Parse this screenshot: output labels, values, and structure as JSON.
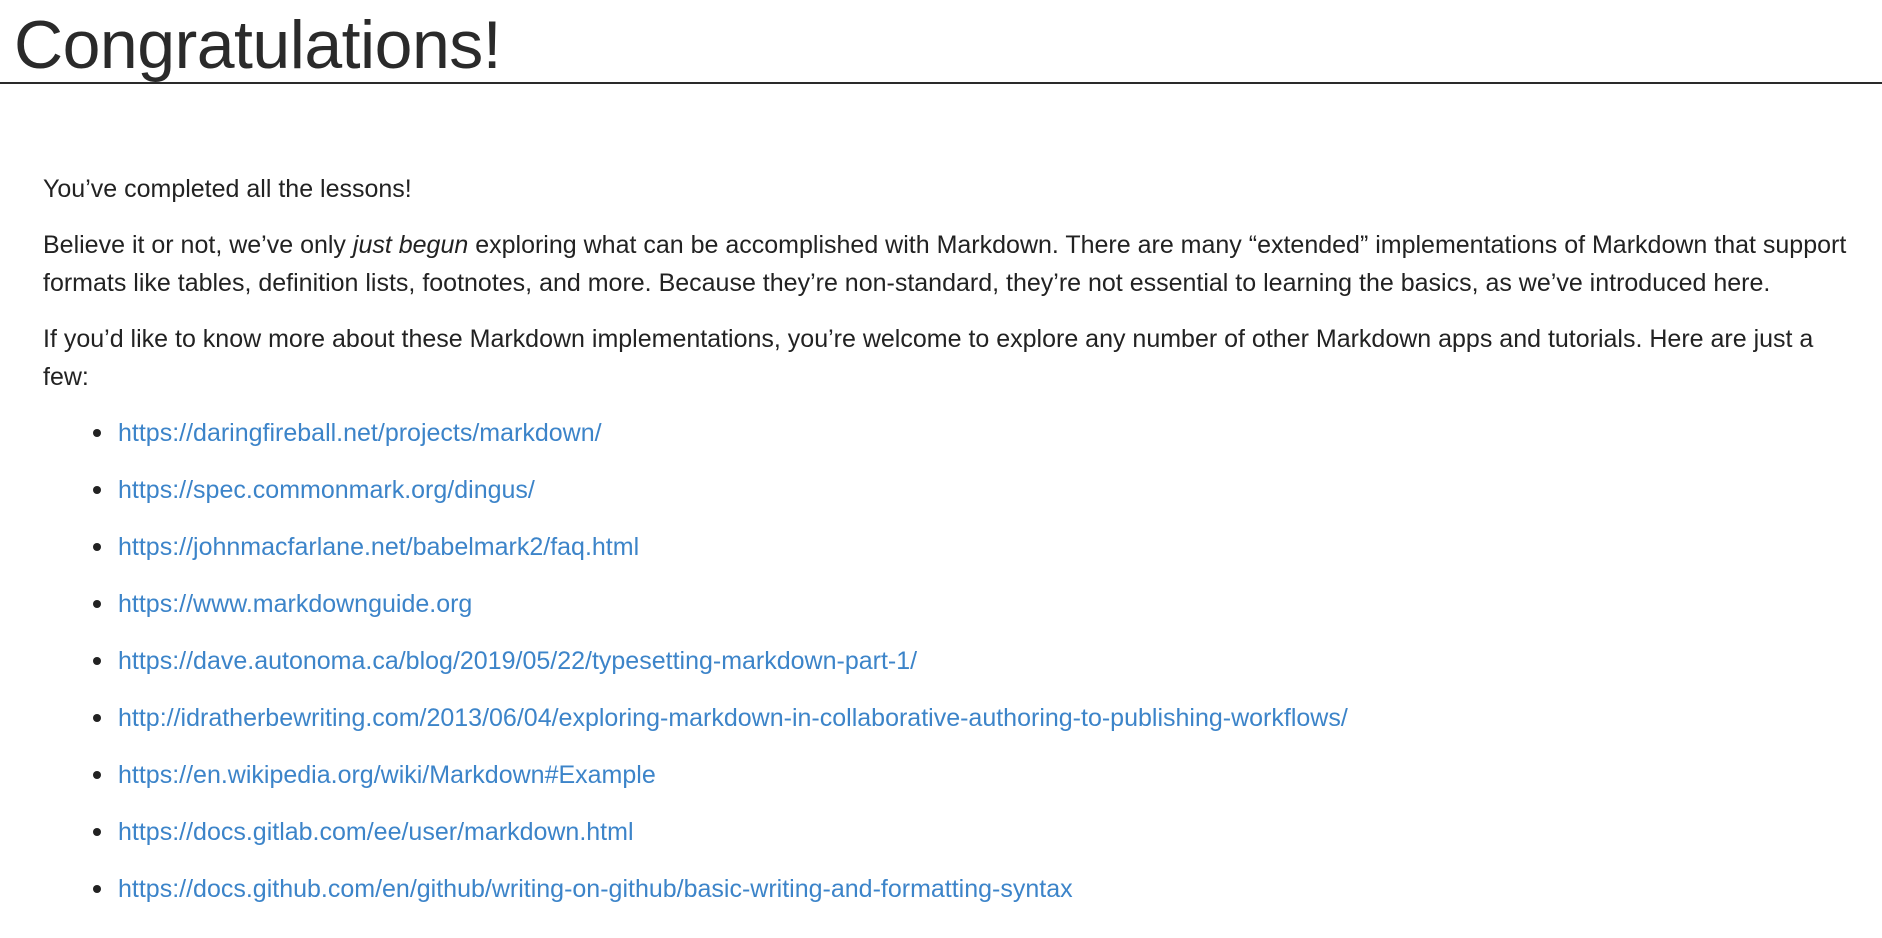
{
  "page": {
    "title": "Congratulations!"
  },
  "content": {
    "p1": "You’ve completed all the lessons!",
    "p2": {
      "before": "Believe it or not, we’ve only ",
      "emphasis": "just begun",
      "after": " exploring what can be accomplished with Markdown. There are many “extended” implementations of Markdown that support formats like tables, definition lists, footnotes, and more. Because they’re non-standard, they’re not essential to learning the basics, as we’ve introduced here."
    },
    "p3": "If you’d like to know more about these Markdown implementations, you’re welcome to explore any number of other Markdown apps and tutorials. Here are just a few:",
    "links": [
      "https://daringfireball.net/projects/markdown/",
      "https://spec.commonmark.org/dingus/",
      "https://johnmacfarlane.net/babelmark2/faq.html",
      "https://www.markdownguide.org",
      "https://dave.autonoma.ca/blog/2019/05/22/typesetting-markdown-part-1/",
      "http://idratherbewriting.com/2013/06/04/exploring-markdown-in-collaborative-authoring-to-publishing-workflows/",
      "https://en.wikipedia.org/wiki/Markdown#Example",
      "https://docs.gitlab.com/ee/user/markdown.html",
      "https://docs.github.com/en/github/writing-on-github/basic-writing-and-formatting-syntax"
    ]
  },
  "colors": {
    "link": "#3c84c9",
    "text": "#222222",
    "background": "#ffffff"
  }
}
